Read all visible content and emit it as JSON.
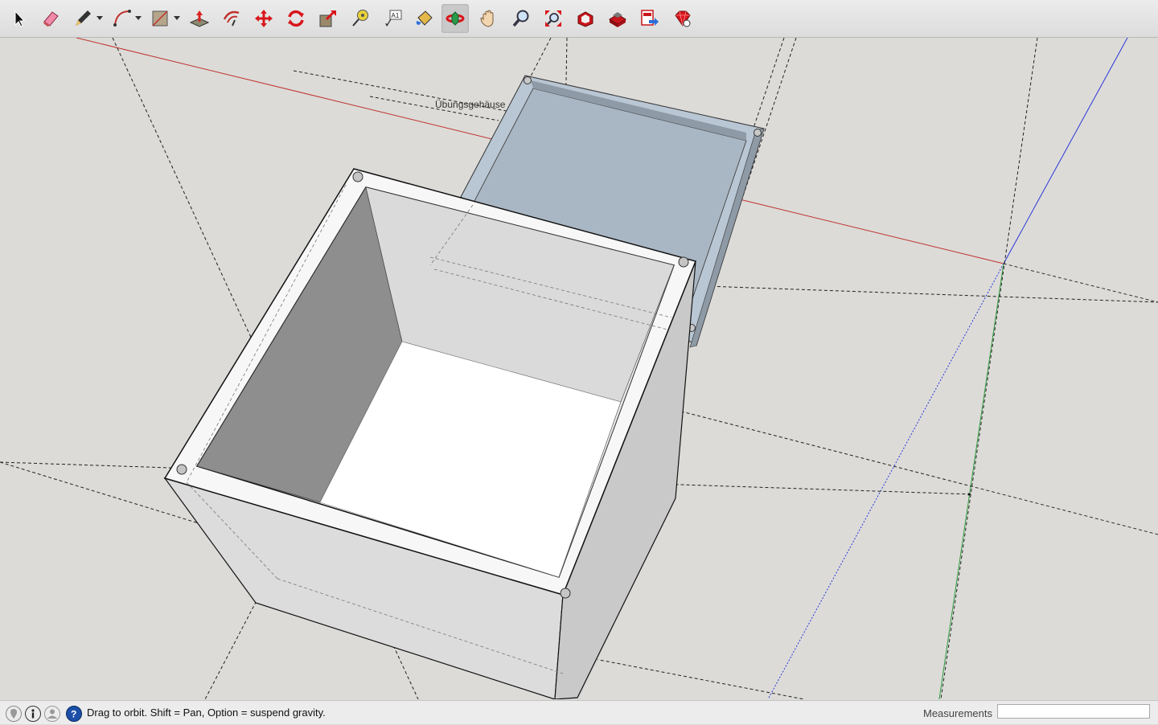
{
  "toolbar": {
    "tools": [
      {
        "name": "select-tool",
        "icon": "arrow-cursor-icon"
      },
      {
        "name": "eraser-tool",
        "icon": "eraser-icon"
      },
      {
        "name": "line-tool",
        "icon": "pencil-icon"
      },
      {
        "name": "arc-tool",
        "icon": "arc-icon"
      },
      {
        "name": "rectangle-tool",
        "icon": "rectangle-icon"
      },
      {
        "name": "push-pull-tool",
        "icon": "push-pull-icon"
      },
      {
        "name": "offset-tool",
        "icon": "offset-icon"
      },
      {
        "name": "move-tool",
        "icon": "move-icon"
      },
      {
        "name": "rotate-tool",
        "icon": "rotate-icon"
      },
      {
        "name": "scale-tool",
        "icon": "scale-icon"
      },
      {
        "name": "tape-measure-tool",
        "icon": "tape-measure-icon"
      },
      {
        "name": "text-tool",
        "icon": "text-icon"
      },
      {
        "name": "paint-bucket-tool",
        "icon": "paint-bucket-icon"
      },
      {
        "name": "orbit-tool",
        "icon": "orbit-icon"
      },
      {
        "name": "pan-tool",
        "icon": "hand-icon"
      },
      {
        "name": "zoom-tool",
        "icon": "magnifier-icon"
      },
      {
        "name": "zoom-extents-tool",
        "icon": "zoom-extents-icon"
      },
      {
        "name": "warehouse-tool",
        "icon": "warehouse-icon"
      },
      {
        "name": "extension-warehouse-tool",
        "icon": "extension-warehouse-icon"
      },
      {
        "name": "layout-send-tool",
        "icon": "send-to-layout-icon"
      },
      {
        "name": "ruby-console-tool",
        "icon": "ruby-icon"
      }
    ],
    "active_tool": "orbit-tool",
    "text_tool_glyph": "A1"
  },
  "viewport": {
    "model_label": "Übungsgehäuse",
    "axis_colors": {
      "red": "#c0322e",
      "green": "#2e9a3a",
      "blue": "#2a36d8"
    }
  },
  "statusbar": {
    "message": "Drag to orbit. Shift = Pan, Option = suspend gravity.",
    "measurements_label": "Measurements",
    "measurements_value": ""
  }
}
